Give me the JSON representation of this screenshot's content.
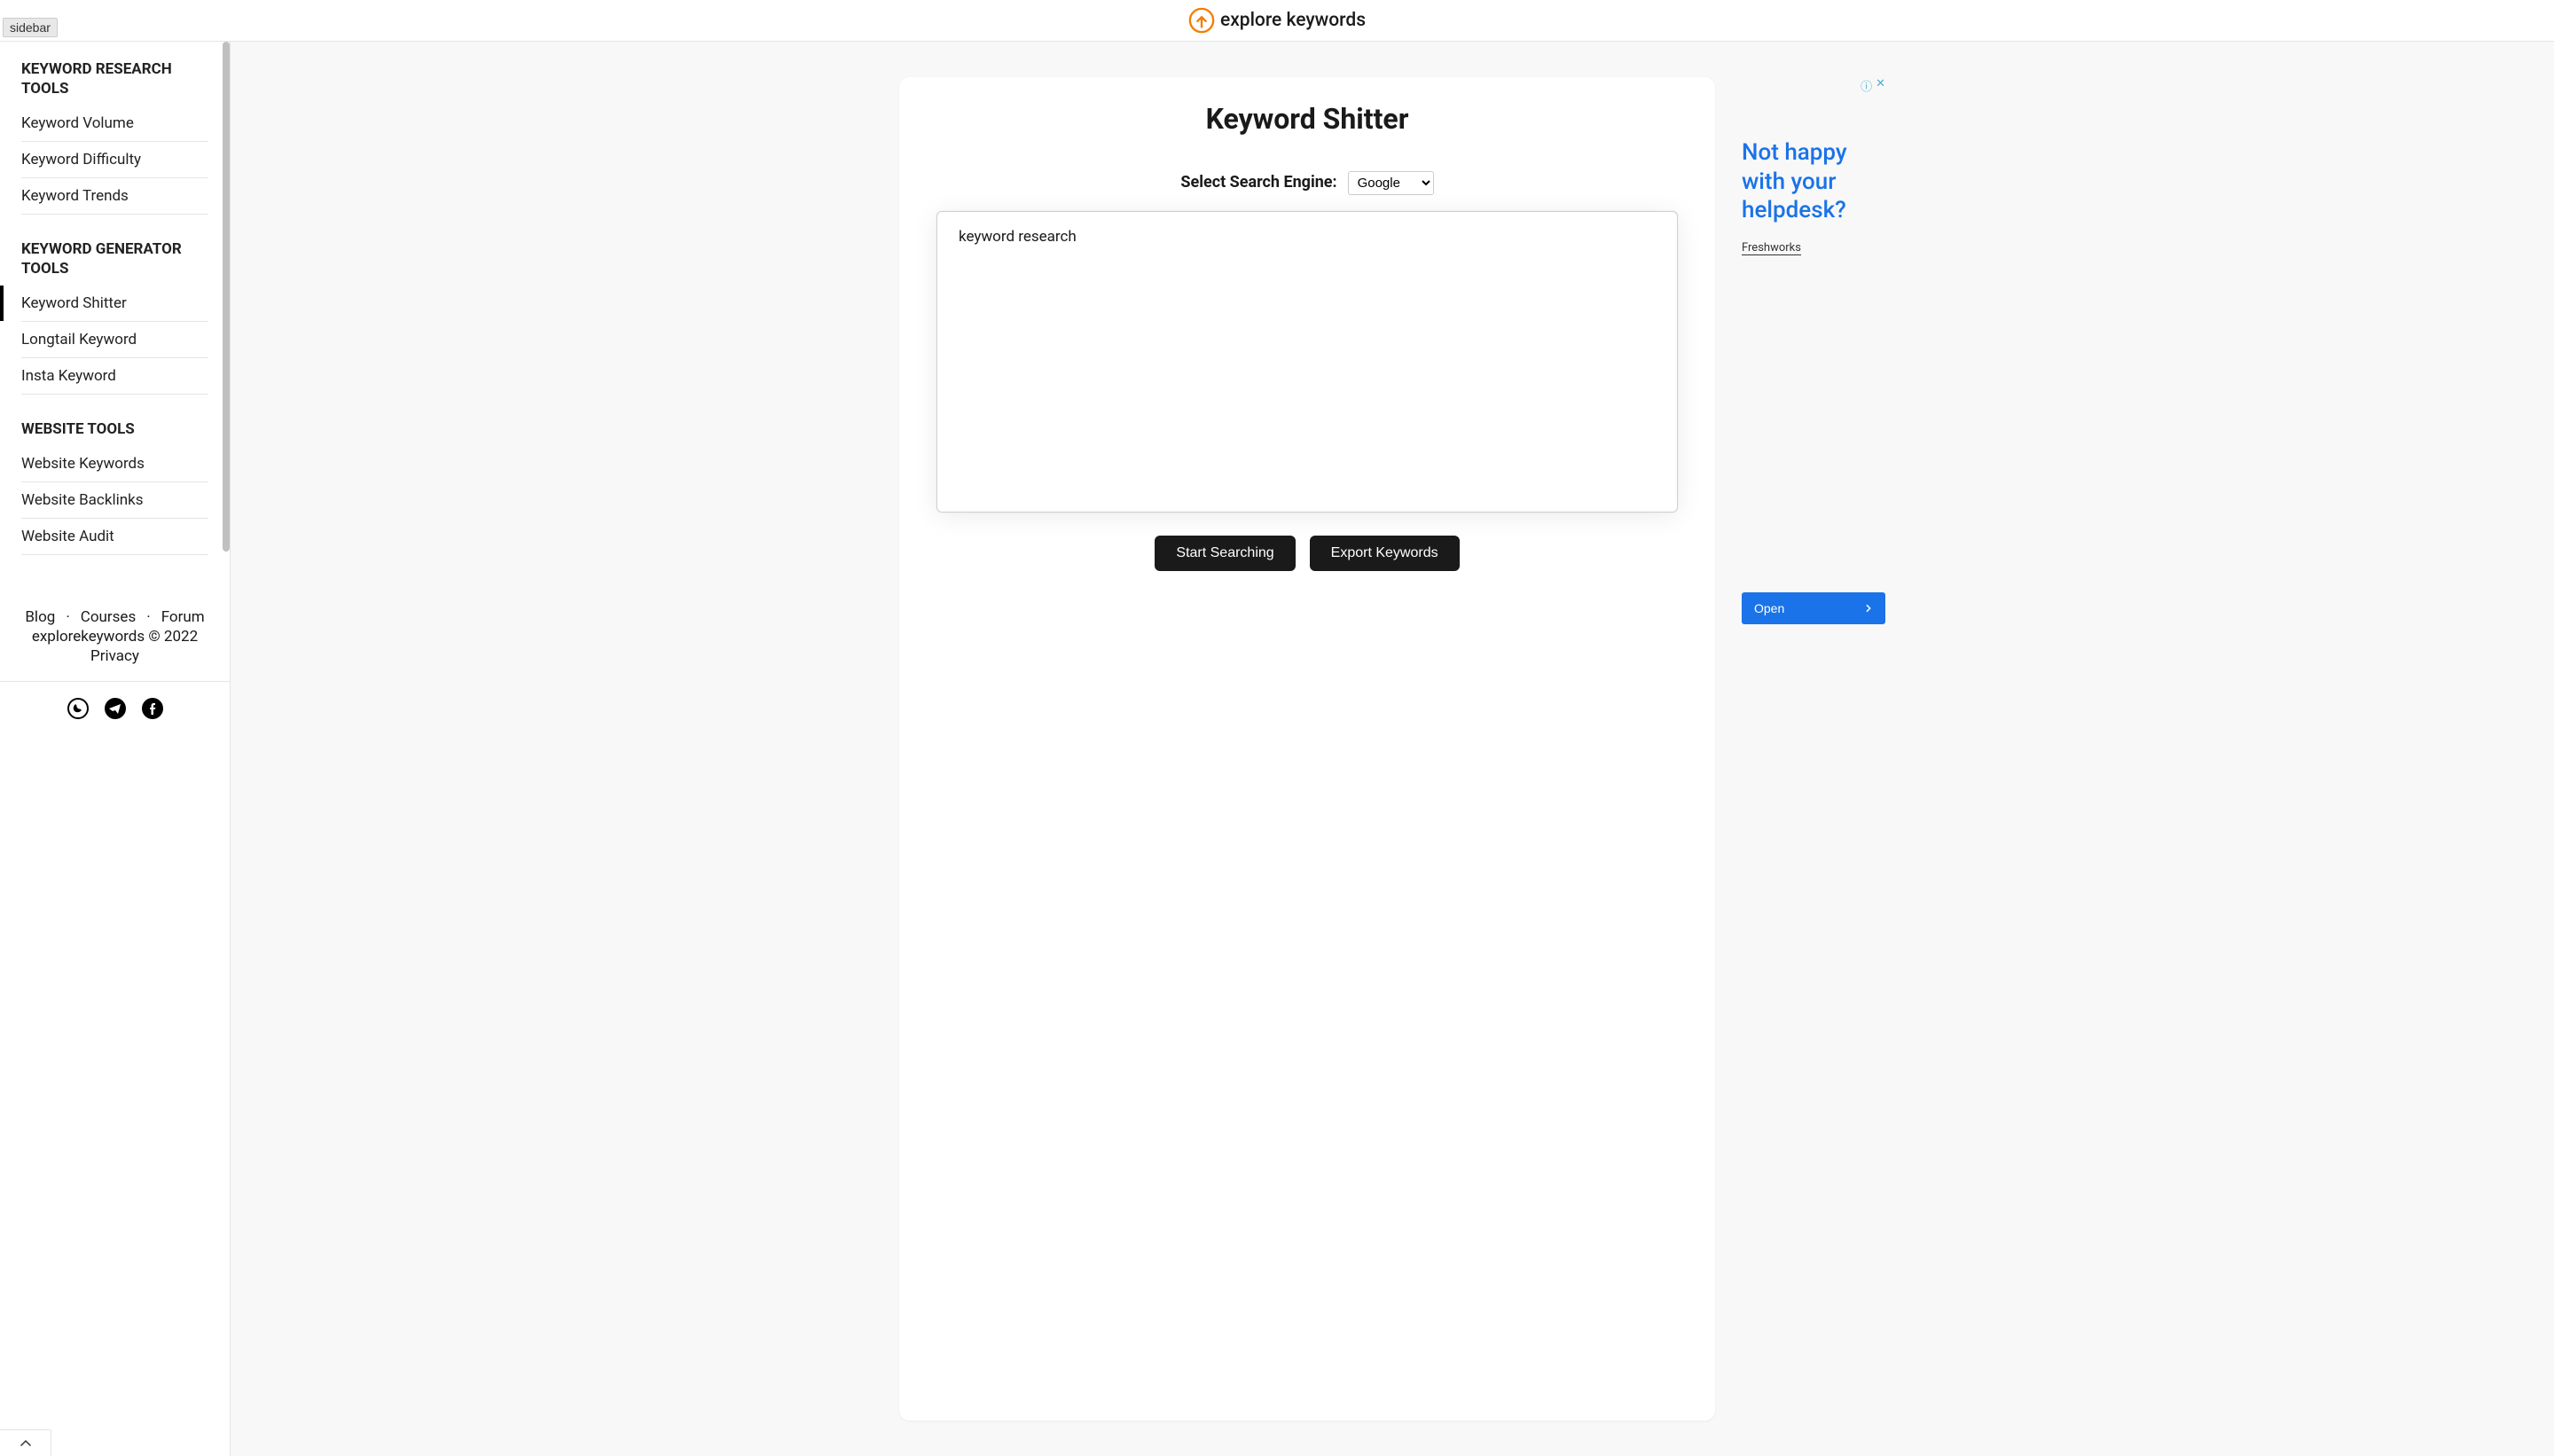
{
  "header": {
    "sidebar_toggle": "sidebar",
    "logo_text": "explore keywords"
  },
  "sidebar": {
    "sections": [
      {
        "title": "KEYWORD RESEARCH TOOLS",
        "items": [
          "Keyword Volume",
          "Keyword Difficulty",
          "Keyword Trends"
        ]
      },
      {
        "title": "KEYWORD GENERATOR TOOLS",
        "items": [
          "Keyword Shitter",
          "Longtail Keyword",
          "Insta Keyword"
        ]
      },
      {
        "title": "WEBSITE TOOLS",
        "items": [
          "Website Keywords",
          "Website Backlinks",
          "Website Audit"
        ]
      }
    ],
    "active_item": "Keyword Shitter",
    "footer": {
      "links": [
        "Blog",
        "Courses",
        "Forum"
      ],
      "copyright": "explorekeywords © 2022",
      "privacy": "Privacy"
    }
  },
  "main": {
    "title": "Keyword Shitter",
    "search_engine_label": "Select Search Engine:",
    "search_engine_selected": "Google",
    "textarea_value": "keyword research",
    "start_button": "Start Searching",
    "export_button": "Export Keywords"
  },
  "ad": {
    "headline": "Not happy with your helpdesk?",
    "brand": "Freshworks",
    "cta": "Open"
  }
}
